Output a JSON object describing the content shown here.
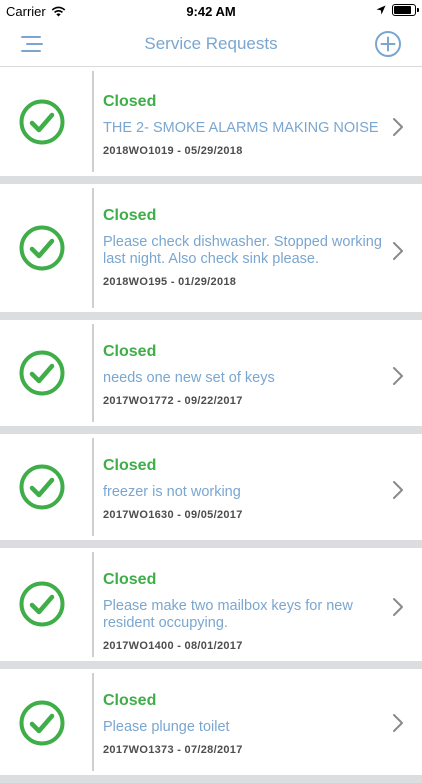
{
  "status_bar": {
    "carrier": "Carrier",
    "time": "9:42 AM"
  },
  "nav": {
    "title": "Service Requests",
    "menu_icon": "hamburger-menu-icon",
    "add_icon": "plus-circle-icon"
  },
  "colors": {
    "accent": "#7aa6cf",
    "status_green": "#3fae49",
    "meta_text": "#4d4d4d"
  },
  "requests": [
    {
      "status": "Closed",
      "description": "THE 2- SMOKE ALARMS MAKING NOISE",
      "meta": "2018WO1019 - 05/29/2018"
    },
    {
      "status": "Closed",
      "description": "Please check dishwasher. Stopped working last night. Also check sink please.",
      "meta": "2018WO195 - 01/29/2018"
    },
    {
      "status": "Closed",
      "description": "needs one new set of keys",
      "meta": "2017WO1772 - 09/22/2017"
    },
    {
      "status": "Closed",
      "description": "freezer is not working",
      "meta": "2017WO1630 - 09/05/2017"
    },
    {
      "status": "Closed",
      "description": "Please make two mailbox keys for new resident occupying.",
      "meta": "2017WO1400 - 08/01/2017"
    },
    {
      "status": "Closed",
      "description": "Please plunge toilet",
      "meta": "2017WO1373 - 07/28/2017"
    }
  ]
}
